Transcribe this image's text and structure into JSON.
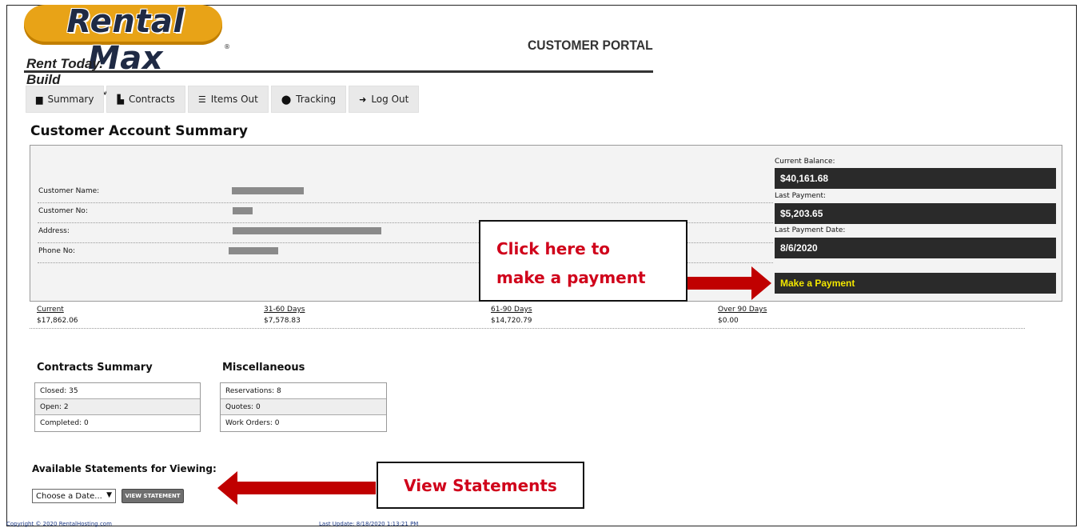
{
  "header": {
    "logo_text": "Rental Max",
    "logo_registered": "®",
    "tagline": "Rent Today. Build Tomorrow.™",
    "portal_title": "CUSTOMER PORTAL"
  },
  "nav": {
    "tabs": [
      {
        "label": "Summary",
        "icon": "clipboard-icon"
      },
      {
        "label": "Contracts",
        "icon": "document-icon"
      },
      {
        "label": "Items Out",
        "icon": "list-icon"
      },
      {
        "label": "Tracking",
        "icon": "map-marker-icon"
      },
      {
        "label": "Log Out",
        "icon": "sign-out-icon"
      }
    ]
  },
  "page_title": "Customer Account Summary",
  "customer": {
    "name_label": "Customer Name:",
    "number_label": "Customer No:",
    "address_label": "Address:",
    "phone_label": "Phone No:"
  },
  "balance": {
    "current_label": "Current Balance:",
    "current_value": "$40,161.68",
    "last_payment_label": "Last Payment:",
    "last_payment_value": "$5,203.65",
    "last_payment_date_label": "Last Payment Date:",
    "last_payment_date_value": "8/6/2020",
    "make_payment_label": "Make a Payment"
  },
  "aging": [
    {
      "label": "Current",
      "value": "$17,862.06"
    },
    {
      "label": "31-60 Days",
      "value": "$7,578.83"
    },
    {
      "label": "61-90 Days",
      "value": "$14,720.79"
    },
    {
      "label": "Over 90 Days",
      "value": "$0.00"
    }
  ],
  "contracts_summary": {
    "title": "Contracts Summary",
    "rows": [
      "Closed: 35",
      "Open: 2",
      "Completed: 0"
    ]
  },
  "miscellaneous": {
    "title": "Miscellaneous",
    "rows": [
      "Reservations: 8",
      "Quotes: 0",
      "Work Orders: 0"
    ]
  },
  "statements": {
    "title": "Available Statements for Viewing:",
    "select_value": "Choose a Date...",
    "view_button_label": "VIEW STATEMENT"
  },
  "footer": {
    "copyright": "Copyright © 2020 RentalHosting.com",
    "last_update": "Last Update: 8/18/2020 1:13:21 PM"
  },
  "annotations": {
    "payment_callout_line1": "Click here to",
    "payment_callout_line2": "make a payment",
    "statements_callout": "View Statements",
    "arrow_color": "#c00000"
  }
}
